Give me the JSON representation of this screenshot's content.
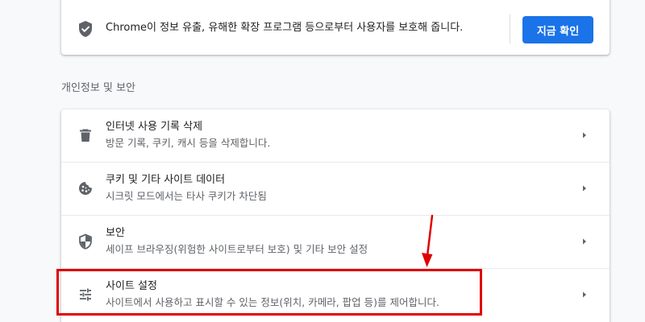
{
  "safety_check": {
    "message": "Chrome이 정보 유출, 유해한 확장 프로그램 등으로부터 사용자를 보호해 줍니다.",
    "button_label": "지금 확인",
    "icon": "shield-check-icon",
    "button_color": "#1a73e8"
  },
  "privacy": {
    "section_title": "개인정보 및 보안",
    "items": [
      {
        "title": "인터넷 사용 기록 삭제",
        "subtitle": "방문 기록, 쿠키, 캐시 등을 삭제합니다.",
        "icon": "trash-icon"
      },
      {
        "title": "쿠키 및 기타 사이트 데이터",
        "subtitle": "시크릿 모드에서는 타사 쿠키가 차단됨",
        "icon": "cookie-icon"
      },
      {
        "title": "보안",
        "subtitle": "세이프 브라우징(위험한 사이트로부터 보호) 및 기타 보안 설정",
        "icon": "security-shield-icon"
      },
      {
        "title": "사이트 설정",
        "subtitle": "사이트에서 사용하고 표시할 수 있는 정보(위치, 카메라, 팝업 등)를 제어합니다.",
        "icon": "tune-sliders-icon"
      }
    ]
  },
  "annotation": {
    "highlight_color": "#e00000"
  }
}
